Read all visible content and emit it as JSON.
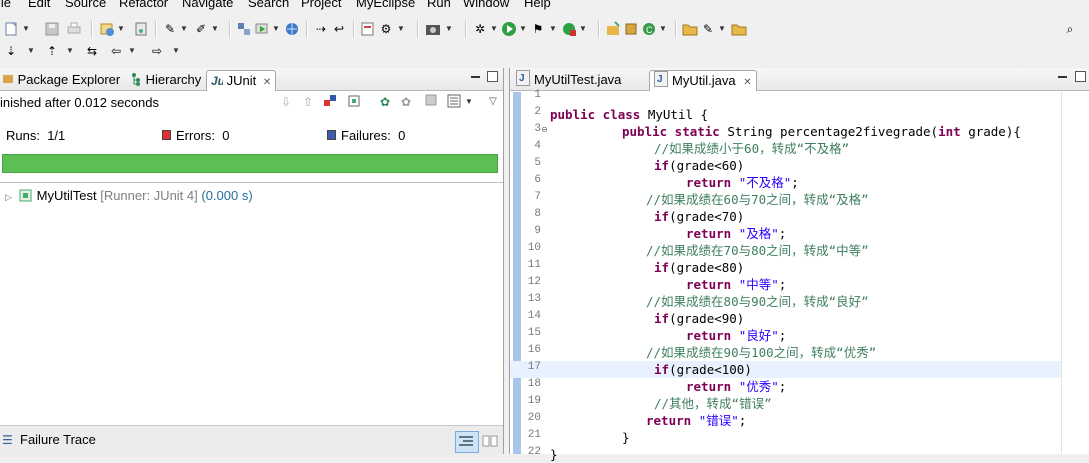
{
  "menu": [
    "ile",
    "Edit",
    "Source",
    "Refactor",
    "Navigate",
    "Search",
    "Project",
    "MyEclipse",
    "Run",
    "Window",
    "Help"
  ],
  "left_panel": {
    "tabs": [
      {
        "label": "Package Explorer",
        "icon": "package-explorer-icon"
      },
      {
        "label": "Hierarchy",
        "icon": "hierarchy-icon"
      },
      {
        "label": "JUnit",
        "icon": "junit-icon",
        "close": "✕"
      }
    ],
    "status": "inished after 0.012 seconds",
    "runs_label": "Runs:",
    "runs_value": "1/1",
    "errors_label": "Errors:",
    "errors_value": "0",
    "failures_label": "Failures:",
    "failures_value": "0",
    "progress": 1.0,
    "progress_color": "#5cbf54",
    "test_name": "MyUtilTest",
    "test_runner": "[Runner: JUnit 4]",
    "test_time": "(0.000 s)",
    "failure_trace": "Failure Trace"
  },
  "editor": {
    "tabs": [
      {
        "label": "MyUtilTest.java",
        "active": false
      },
      {
        "label": "MyUtil.java",
        "active": true,
        "close": "✕"
      }
    ],
    "highlight_line": 17,
    "lines": [
      {
        "n": "1",
        "indent": 0,
        "parts": []
      },
      {
        "n": "2",
        "indent": 0,
        "parts": [
          {
            "c": "kw",
            "t": "public class "
          },
          {
            "c": "pl",
            "t": "MyUtil {"
          }
        ]
      },
      {
        "n": "3",
        "indent": 72,
        "fold": true,
        "parts": [
          {
            "c": "kw",
            "t": "public static "
          },
          {
            "c": "pl",
            "t": "String percentage2fivegrade("
          },
          {
            "c": "kw",
            "t": "int "
          },
          {
            "c": "pl",
            "t": "grade){"
          }
        ]
      },
      {
        "n": "4",
        "indent": 104,
        "parts": [
          {
            "c": "cm",
            "t": "//如果成绩小于60，转成“不及格”"
          }
        ]
      },
      {
        "n": "5",
        "indent": 104,
        "parts": [
          {
            "c": "kw",
            "t": "if"
          },
          {
            "c": "pl",
            "t": "(grade<60)"
          }
        ]
      },
      {
        "n": "6",
        "indent": 136,
        "parts": [
          {
            "c": "kw",
            "t": "return "
          },
          {
            "c": "st",
            "t": "\"不及格\""
          },
          {
            "c": "pl",
            "t": ";"
          }
        ]
      },
      {
        "n": "7",
        "indent": 96,
        "parts": [
          {
            "c": "cm",
            "t": "//如果成绩在60与70之间，转成“及格”"
          }
        ]
      },
      {
        "n": "8",
        "indent": 104,
        "parts": [
          {
            "c": "kw",
            "t": "if"
          },
          {
            "c": "pl",
            "t": "(grade<70)"
          }
        ]
      },
      {
        "n": "9",
        "indent": 136,
        "parts": [
          {
            "c": "kw",
            "t": "return "
          },
          {
            "c": "st",
            "t": "\"及格\""
          },
          {
            "c": "pl",
            "t": ";"
          }
        ]
      },
      {
        "n": "10",
        "indent": 96,
        "parts": [
          {
            "c": "cm",
            "t": "//如果成绩在70与80之间，转成“中等”"
          }
        ]
      },
      {
        "n": "11",
        "indent": 104,
        "parts": [
          {
            "c": "kw",
            "t": "if"
          },
          {
            "c": "pl",
            "t": "(grade<80)"
          }
        ]
      },
      {
        "n": "12",
        "indent": 136,
        "parts": [
          {
            "c": "kw",
            "t": "return "
          },
          {
            "c": "st",
            "t": "\"中等\""
          },
          {
            "c": "pl",
            "t": ";"
          }
        ]
      },
      {
        "n": "13",
        "indent": 96,
        "parts": [
          {
            "c": "cm",
            "t": "//如果成绩在80与90之间，转成“良好”"
          }
        ]
      },
      {
        "n": "14",
        "indent": 104,
        "parts": [
          {
            "c": "kw",
            "t": "if"
          },
          {
            "c": "pl",
            "t": "(grade<90)"
          }
        ]
      },
      {
        "n": "15",
        "indent": 136,
        "parts": [
          {
            "c": "kw",
            "t": "return "
          },
          {
            "c": "st",
            "t": "\"良好\""
          },
          {
            "c": "pl",
            "t": ";"
          }
        ]
      },
      {
        "n": "16",
        "indent": 96,
        "parts": [
          {
            "c": "cm",
            "t": "//如果成绩在90与100之间，转成“优秀”"
          }
        ]
      },
      {
        "n": "17",
        "indent": 104,
        "parts": [
          {
            "c": "kw",
            "t": "if"
          },
          {
            "c": "pl",
            "t": "(grade<100)"
          }
        ]
      },
      {
        "n": "18",
        "indent": 136,
        "parts": [
          {
            "c": "kw",
            "t": "return "
          },
          {
            "c": "st",
            "t": "\"优秀\""
          },
          {
            "c": "pl",
            "t": ";"
          }
        ]
      },
      {
        "n": "19",
        "indent": 104,
        "parts": [
          {
            "c": "cm",
            "t": "//其他，转成“错误”"
          }
        ]
      },
      {
        "n": "20",
        "indent": 96,
        "parts": [
          {
            "c": "kw",
            "t": "return "
          },
          {
            "c": "st",
            "t": "\"错误\""
          },
          {
            "c": "pl",
            "t": ";"
          }
        ]
      },
      {
        "n": "21",
        "indent": 72,
        "parts": [
          {
            "c": "pl",
            "t": "}"
          }
        ]
      },
      {
        "n": "22",
        "indent": 0,
        "parts": [
          {
            "c": "pl",
            "t": "}"
          }
        ]
      }
    ]
  }
}
